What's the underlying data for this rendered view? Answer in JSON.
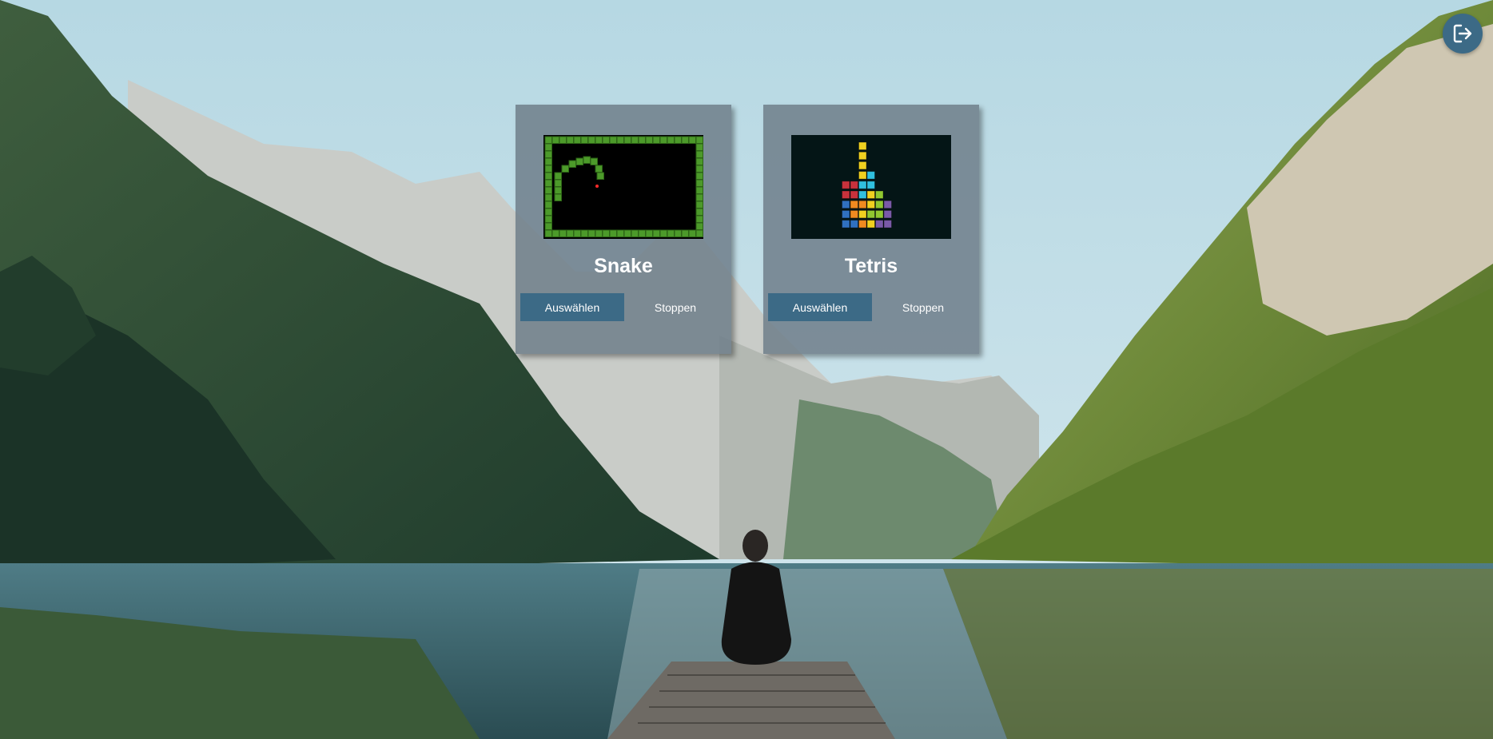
{
  "games": [
    {
      "title": "Snake",
      "select_label": "Auswählen",
      "stop_label": "Stoppen",
      "thumbnail": "snake-game-preview"
    },
    {
      "title": "Tetris",
      "select_label": "Auswählen",
      "stop_label": "Stoppen",
      "thumbnail": "tetris-game-preview"
    }
  ],
  "header": {
    "exit_icon": "logout-icon"
  },
  "background": {
    "scene": "mountain-lake-photo"
  },
  "colors": {
    "card_bg": "#6e7e8a",
    "button_primary": "#3c6a86",
    "snake_green": "#4c9a2a",
    "snake_food": "#ff2a2a",
    "tetris_red": "#c8323c",
    "tetris_yellow": "#f0d020",
    "tetris_cyan": "#30c0e0",
    "tetris_blue": "#3070c0",
    "tetris_orange": "#f08a20",
    "tetris_green": "#90c830",
    "tetris_purple": "#7a5aa8"
  }
}
